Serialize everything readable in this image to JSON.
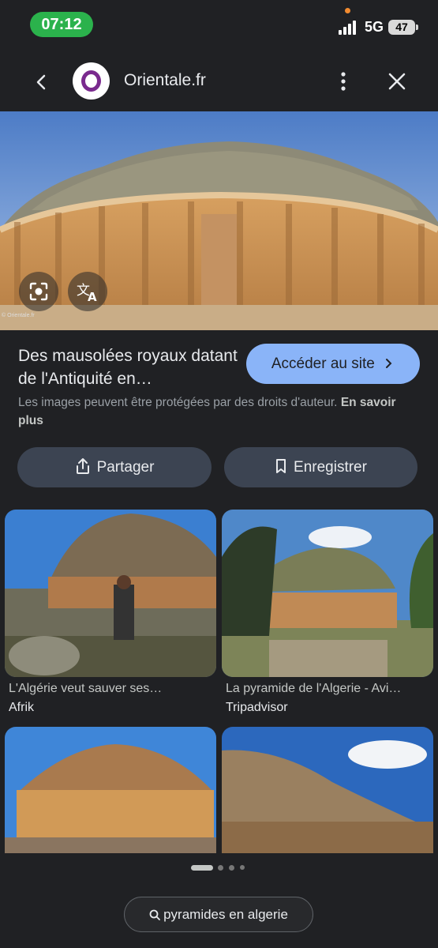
{
  "status_bar": {
    "time": "07:12",
    "network": "5G",
    "battery": "47"
  },
  "header": {
    "site_name": "Orientale.fr"
  },
  "hero": {
    "caption": "© Orientale.fr"
  },
  "result": {
    "title": "Des mausolées royaux datant de l'Antiquité en…",
    "visit_label": "Accéder au site",
    "copyright_text": "Les images peuvent être protégées par des droits d'auteur.",
    "learn_more": "En savoir plus"
  },
  "actions": {
    "share_label": "Partager",
    "save_label": "Enregistrer"
  },
  "related": [
    {
      "title": "L'Algérie veut sauver ses…",
      "source": "Afrik"
    },
    {
      "title": "La pyramide de l'Algerie - Avi…",
      "source": "Tripadvisor"
    }
  ],
  "search_chip": {
    "label": "pyramides en algerie"
  },
  "icons": [
    "back-arrow-icon",
    "more-vert-icon",
    "close-icon",
    "lens-icon",
    "translate-icon",
    "share-icon",
    "bookmark-icon",
    "search-icon"
  ]
}
